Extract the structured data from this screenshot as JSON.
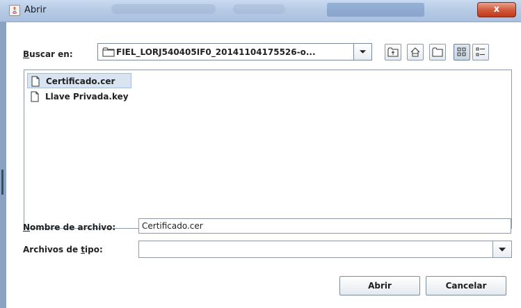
{
  "window": {
    "title": "Abrir",
    "close_glyph": "x"
  },
  "look_in": {
    "label_mnemonic": "B",
    "label_rest": "uscar en:",
    "path": "FIEL_LORJ540405IF0_20141104175526-o..."
  },
  "toolbar": {
    "icons": [
      "up-one-level-icon",
      "home-icon",
      "new-folder-icon",
      "list-view-icon",
      "details-view-icon"
    ],
    "active_view": "list-view-icon"
  },
  "files": [
    {
      "name": "Certificado.cer",
      "selected": true
    },
    {
      "name": "Llave Privada.key",
      "selected": false
    }
  ],
  "filename": {
    "label_mnemonic": "N",
    "label_rest": "ombre de archivo:",
    "value": "Certificado.cer"
  },
  "filetype": {
    "label_pre": "Archivos de ",
    "label_mnemonic": "t",
    "label_post": "ipo:",
    "value": ""
  },
  "buttons": {
    "open": "Abrir",
    "cancel": "Cancelar"
  },
  "colors": {
    "close_button": "#c1381a",
    "selection": "#d8e4f1"
  }
}
